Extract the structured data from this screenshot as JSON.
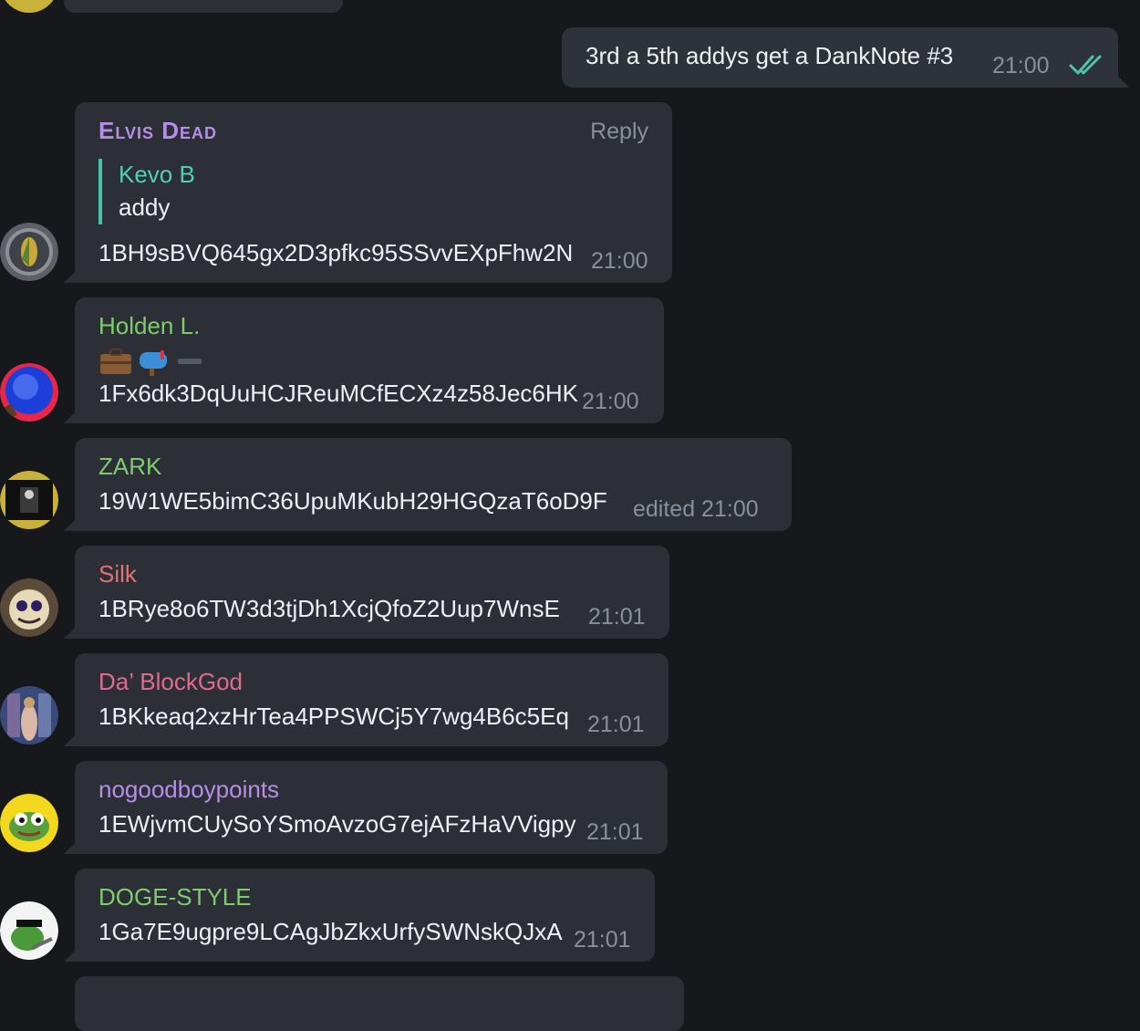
{
  "colors": {
    "background": "#17181c",
    "bubble": "#2c2f36",
    "time": "#8a9099",
    "read_check": "#4fc3a6"
  },
  "outgoing": {
    "text": "3rd a 5th addys get a DankNote #3",
    "time": "21:00",
    "status_icon": "double-check-icon"
  },
  "messages": [
    {
      "sender": "Elvis Dead",
      "sender_color": "#b48eea",
      "reply_label": "Reply",
      "quote": {
        "name": "Kevo B",
        "text": "addy"
      },
      "text": "1BH9sBVQ645gx2D3pfkc95SSvvEXpFhw2N",
      "time": "21:00"
    },
    {
      "sender": "Holden L.",
      "sender_color": "#7fcc6d",
      "emoji_line": "briefcase-icon mailbox-icon minus-icon",
      "text": "1Fx6dk3DqUuHCJReuMCfECXz4z58Jec6HK",
      "time": "21:00"
    },
    {
      "sender": "ZARK",
      "sender_color": "#7fcc6d",
      "text": "19W1WE5bimC36UpuMKubH29HGQzaT6oD9F",
      "time": "edited 21:00"
    },
    {
      "sender": "Silk",
      "sender_color": "#e57070",
      "text": "1BRye8o6TW3d3tjDh1XcjQfoZ2Uup7WnsE",
      "time": "21:01"
    },
    {
      "sender": "Da’ BlockGod",
      "sender_color": "#e06b8b",
      "text": "1BKkeaq2xzHrTea4PPSWCj5Y7wg4B6c5Eq",
      "time": "21:01"
    },
    {
      "sender": "nogoodboypoints",
      "sender_color": "#b48eea",
      "text": "1EWjvmCUySoYSmoAvzoG7ejAFzHaVVigpy",
      "time": "21:01"
    },
    {
      "sender": "DOGE-STYLE",
      "sender_color": "#7fcc6d",
      "text": "1Ga7E9ugpre9LCAgJbZkxUrfySWNskQJxA",
      "time": "21:01"
    }
  ]
}
